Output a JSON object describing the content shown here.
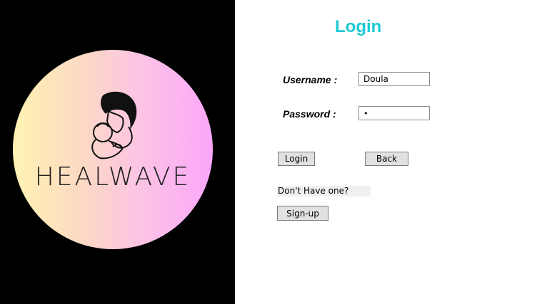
{
  "logo": {
    "text": "HEALWAVE",
    "icon": "mother-baby-icon"
  },
  "form": {
    "title": "Login",
    "username_label": "Username :",
    "username_value": "Doula",
    "password_label": "Password  :",
    "password_value": "•",
    "login_label": "Login",
    "back_label": "Back",
    "no_account_text": "Don't Have one?",
    "signup_label": "Sign-up"
  },
  "colors": {
    "title": "#1ec9d3",
    "left_background": "#000000",
    "button_face": "#e1e1e1"
  }
}
